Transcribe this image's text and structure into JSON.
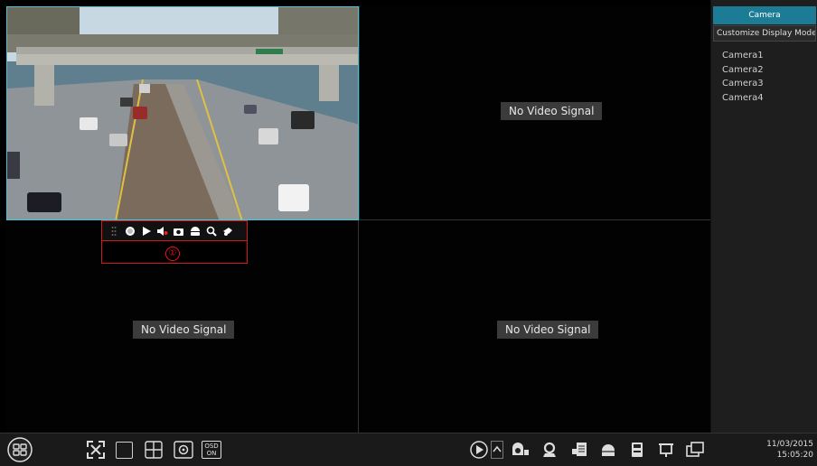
{
  "tiles": [
    {
      "id": "camera1",
      "status": "live"
    },
    {
      "id": "camera2",
      "status_text": "No Video Signal"
    },
    {
      "id": "camera3",
      "status_text": "No Video Signal"
    },
    {
      "id": "camera4",
      "status_text": "No Video Signal"
    }
  ],
  "camera_toolbar": {
    "marker": "①",
    "icons": [
      "drag-handle-icon",
      "record-icon",
      "playback-icon",
      "mute-icon",
      "snapshot-icon",
      "ptz-icon",
      "zoom-icon",
      "dome-icon"
    ]
  },
  "side_panel": {
    "header": "Camera",
    "display_mode": "Customize Display Modes",
    "cameras": [
      "Camera1",
      "Camera2",
      "Camera3",
      "Camera4"
    ]
  },
  "bottom_bar": {
    "osd_label_top": "OSD",
    "osd_label_bottom": "ON",
    "date": "11/03/2015",
    "time": "15:05:20",
    "left_icons": [
      "start-menu-icon",
      "fullscreen-icon",
      "single-screen-icon",
      "quad-screen-icon",
      "sequence-icon",
      "osd-icon"
    ],
    "right_icons": [
      "playback-icon",
      "expand-up-icon",
      "record-status-icon",
      "alarm-icon",
      "manual-alarm-icon",
      "disk-icon",
      "backup-icon",
      "network-icon",
      "info-icon"
    ]
  },
  "colors": {
    "accent": "#1c7c96",
    "selected_border": "#43c7e0",
    "toolbar_border": "#d21a1a"
  }
}
